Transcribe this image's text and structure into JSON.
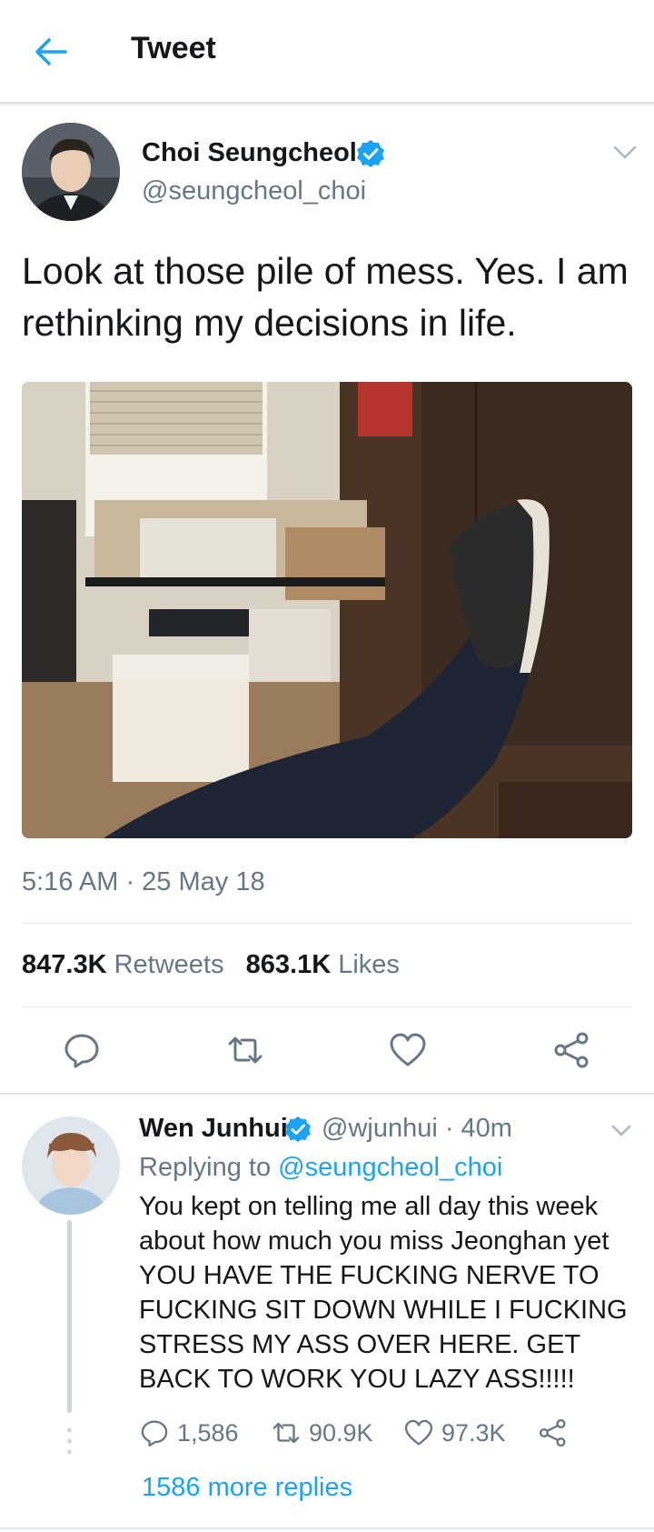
{
  "header": {
    "title": "Tweet",
    "back_icon": "arrow-left-icon"
  },
  "tweet": {
    "author": {
      "name": "Choi Seungcheol",
      "handle": "@seungcheol_choi",
      "verified": true
    },
    "text": "Look at those pile of mess. Yes. I am rethinking my decisions in life.",
    "timestamp": "5:16 AM · 25 May 18",
    "retweets_count": "847.3K",
    "retweets_label": "Retweets",
    "likes_count": "863.1K",
    "likes_label": "Likes",
    "actions": [
      "reply-icon",
      "retweet-icon",
      "like-icon",
      "share-icon"
    ]
  },
  "reply": {
    "author": {
      "name": "Wen Junhui",
      "verified": true
    },
    "handle_time": "@wjunhui · 40m",
    "replying_prefix": "Replying to",
    "replying_mention": "@seungcheol_choi",
    "text": "You kept on telling me all day this week about how much you miss Jeonghan yet YOU HAVE THE FUCKING NERVE TO FUCKING SIT DOWN WHILE I FUCKING STRESS MY ASS OVER HERE. GET BACK TO WORK YOU LAZY ASS!!!!!",
    "reply_count": "1,586",
    "retweet_count": "90.9K",
    "like_count": "97.3K",
    "more_replies": "1586 more replies"
  },
  "colors": {
    "accent": "#1da1f2",
    "text": "#14171a",
    "secondary": "#657786",
    "divider": "#e1e8ed"
  }
}
